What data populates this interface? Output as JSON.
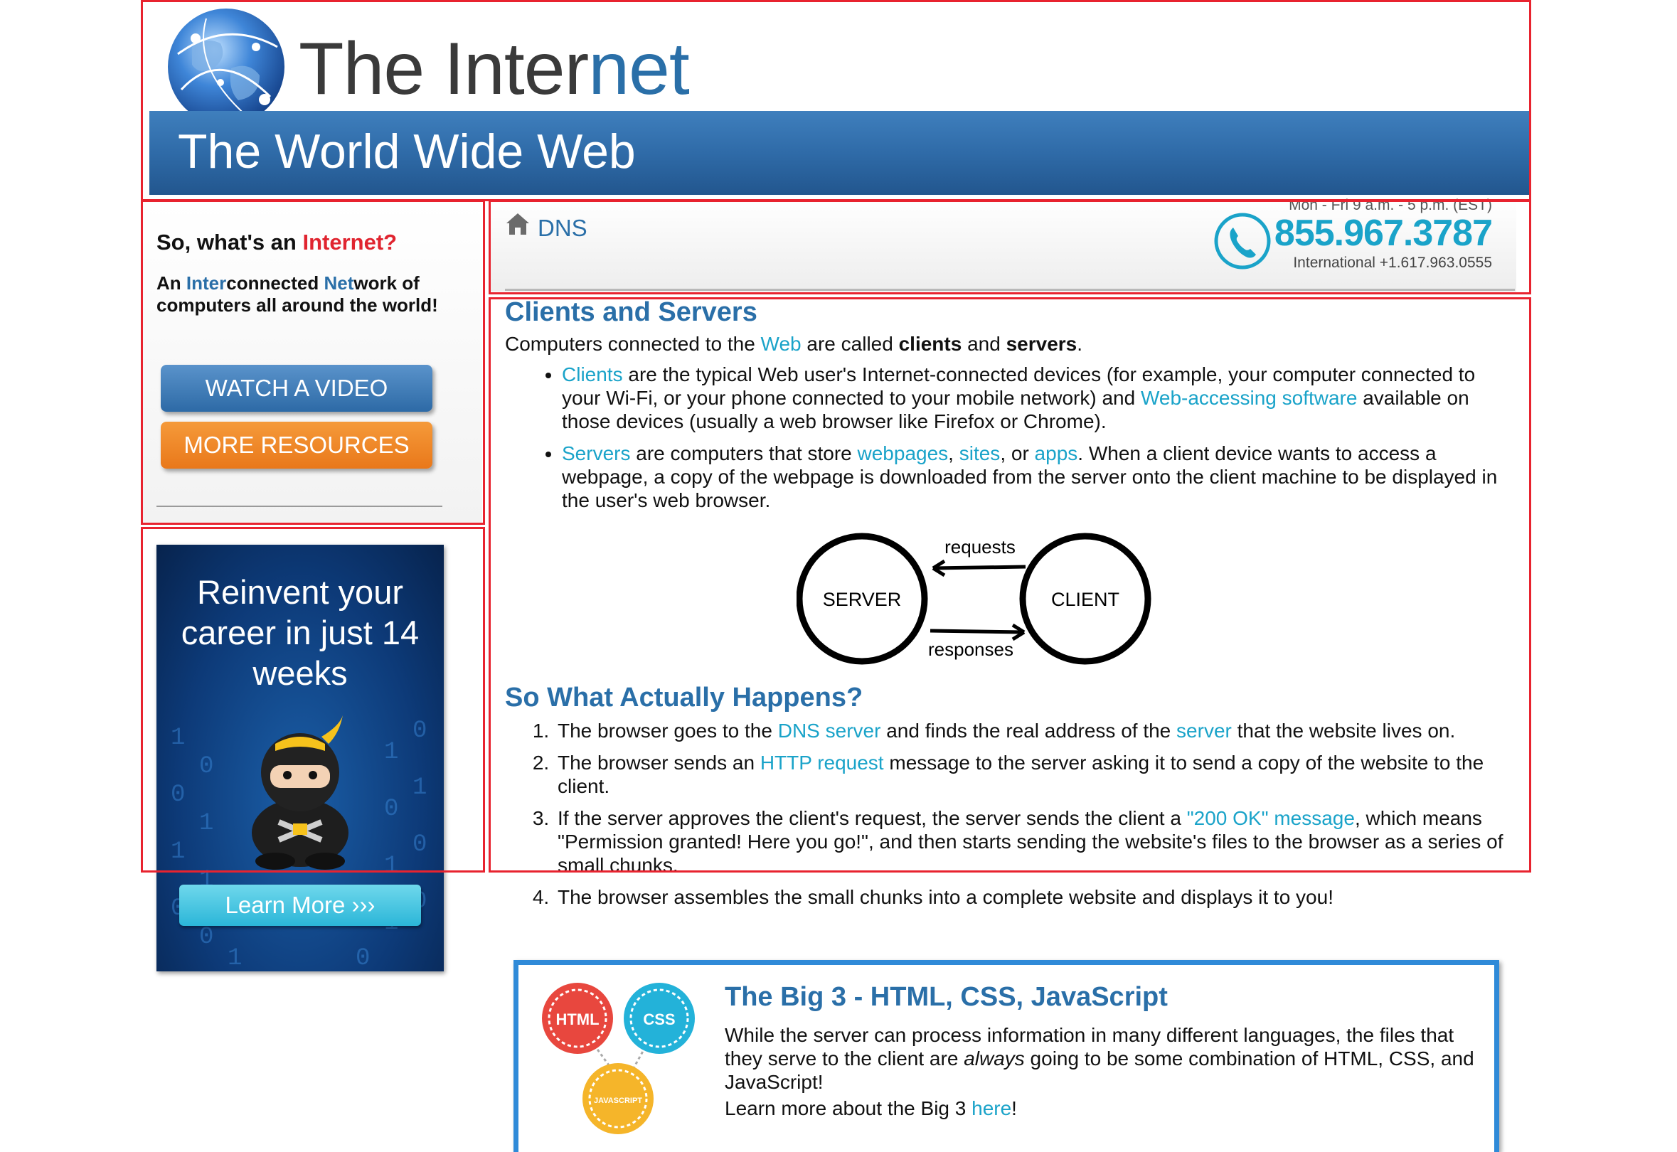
{
  "header": {
    "title_part1": "The Inter",
    "title_part2": "net",
    "banner": "The World Wide Web"
  },
  "sidebar": {
    "heading_prefix": "So, what's an ",
    "heading_highlight": "Internet?",
    "desc_a": "An ",
    "desc_b": "Inter",
    "desc_c": "connected ",
    "desc_d": "Net",
    "desc_e": "work of computers all around the world!",
    "watch_button": "WATCH A VIDEO",
    "resources_button": "MORE RESOURCES"
  },
  "ad": {
    "headline": "Reinvent your career in just 14 weeks",
    "button": "Learn More ›››"
  },
  "breadcrumb": {
    "label": "DNS",
    "hours": "Mon - Fri 9 a.m. - 5 p.m. (EST)",
    "phone": "855.967.3787",
    "international": "International +1.617.963.0555"
  },
  "clients": {
    "title": "Clients and Servers",
    "intro_a": "Computers connected to the ",
    "intro_link": "Web",
    "intro_b": " are called ",
    "intro_bold1": "clients",
    "intro_c": " and ",
    "intro_bold2": "servers",
    "intro_d": ".",
    "b1_link": "Clients",
    "b1_a": " are the typical Web user's Internet-connected devices (for example, your computer connected to your Wi-Fi, or your phone connected to your mobile network) and ",
    "b1_link2": "Web-accessing software",
    "b1_b": " available on those devices (usually a web browser like Firefox or Chrome).",
    "b2_link": "Servers",
    "b2_a": " are computers that store ",
    "b2_link2": "webpages",
    "b2_sep1": ", ",
    "b2_link3": "sites",
    "b2_sep2": ", or ",
    "b2_link4": "apps",
    "b2_b": ". When a client device wants to access a webpage, a copy of the webpage is downloaded from the server onto the client machine to be displayed in the user's web browser."
  },
  "diagram": {
    "server": "SERVER",
    "client": "CLIENT",
    "requests": "requests",
    "responses": "responses"
  },
  "happens": {
    "title": "So What Actually Happens?",
    "s1_a": "The browser goes to the ",
    "s1_link": "DNS server",
    "s1_b": " and finds the real address of the ",
    "s1_link2": "server",
    "s1_c": " that the website lives on.",
    "s2_a": "The browser sends an ",
    "s2_link": "HTTP request",
    "s2_b": " message to the server asking it to send a copy of the website to the client.",
    "s3_a": "If the server approves the client's request, the server sends the client a ",
    "s3_link": "\"200 OK\" message",
    "s3_b": ", which means \"Permission granted! Here you go!\", and then starts sending the website's files to the browser as a series of small chunks.",
    "s4": "The browser assembles the small chunks into a complete website and displays it to you!"
  },
  "big3": {
    "title": "The Big 3 - HTML, CSS, JavaScript",
    "text_a": "While the server can process information in many different languages, the files that they serve to the client are ",
    "text_em": "always",
    "text_b": " going to be some combination of HTML, CSS, and JavaScript!",
    "more_a": "Learn more about the Big 3 ",
    "more_link": "here",
    "more_b": "!",
    "badge_html": "HTML",
    "badge_css": "CSS",
    "badge_js": "JAVASCRIPT"
  },
  "colors": {
    "brand_blue": "#2a6fa8",
    "link_cyan": "#1aa3c9",
    "accent_red": "#e0242f",
    "orange": "#e9781a",
    "annotation_red": "#e8232f"
  },
  "icons": [
    "globe-icon",
    "home-icon",
    "phone-icon",
    "ninja-icon"
  ]
}
